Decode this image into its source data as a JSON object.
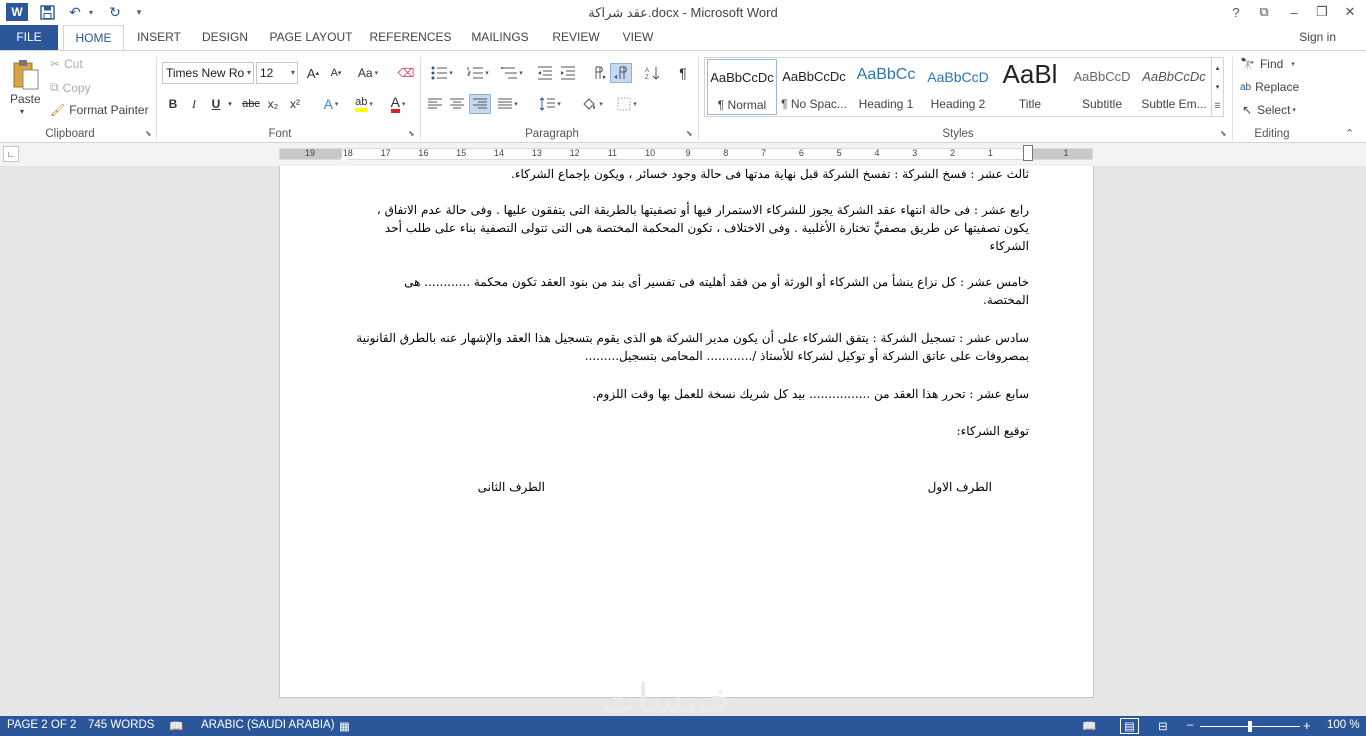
{
  "window": {
    "title": "عقد شراكة.docx - Microsoft Word",
    "help": "?",
    "ribbon_display": "⧉",
    "minimize": "–",
    "maximize": "❐",
    "close": "✕"
  },
  "quick_access": {
    "word_icon": "W",
    "save_icon": "💾",
    "undo_icon": "↶",
    "redo_icon": "↻",
    "customize_icon": "▾"
  },
  "tabs": [
    {
      "label": "FILE"
    },
    {
      "label": "HOME"
    },
    {
      "label": "INSERT"
    },
    {
      "label": "DESIGN"
    },
    {
      "label": "PAGE LAYOUT"
    },
    {
      "label": "REFERENCES"
    },
    {
      "label": "MAILINGS"
    },
    {
      "label": "REVIEW"
    },
    {
      "label": "VIEW"
    }
  ],
  "signin": "Sign in",
  "clipboard": {
    "paste": "Paste",
    "cut": "Cut",
    "copy": "Copy",
    "format_painter": "Format Painter",
    "label": "Clipboard"
  },
  "font": {
    "name": "Times New Ro",
    "size": "12",
    "label": "Font",
    "bold": "B",
    "italic": "I",
    "underline": "U",
    "strikethrough": "abc",
    "subscript": "x₂",
    "superscript": "x²",
    "grow": "A",
    "shrink": "A",
    "change_case": "Aa",
    "text_effects": "A",
    "highlight": "ab",
    "font_color": "A"
  },
  "paragraph": {
    "label": "Paragraph"
  },
  "styles": {
    "label": "Styles",
    "items": [
      {
        "sample": "AaBbCcDc",
        "name": "¶ Normal"
      },
      {
        "sample": "AaBbCcDc",
        "name": "¶ No Spac..."
      },
      {
        "sample": "AaBbCc",
        "name": "Heading 1"
      },
      {
        "sample": "AaBbCcD",
        "name": "Heading 2"
      },
      {
        "sample": "AaBl",
        "name": "Title"
      },
      {
        "sample": "AaBbCcD",
        "name": "Subtitle"
      },
      {
        "sample": "AaBbCcDc",
        "name": "Subtle Em..."
      }
    ]
  },
  "editing": {
    "find": "Find",
    "replace": "Replace",
    "select": "Select",
    "label": "Editing"
  },
  "ruler": {
    "numbers": [
      "19",
      "18",
      "17",
      "16",
      "15",
      "14",
      "13",
      "12",
      "11",
      "10",
      "9",
      "8",
      "7",
      "6",
      "5",
      "4",
      "3",
      "2",
      "1",
      "1"
    ]
  },
  "document": {
    "paragraphs": [
      "ثالث عشر : فسخ الشركة : تفسخ الشركة قبل نهاية مدتها فى حالة وجود خسائر ، ويكون بإجماع الشركاء.",
      "رابع عشر : فى حالة انتهاء عقد الشركة يجوز للشركاء الاستمرار فيها أو تصفيتها بالطريقة التى يتفقون عليها . وفى حالة عدم الاتفاق ، يكون تصفيتها عن طريق مصفيٍّ تختارة الأغلبية . وفى الاختلاف ، تكون المحكمة المختصة هى التى تتولى التصفية بناء على طلب أحد الشركاء",
      "خامس عشر : كل نزاع ينشأ من الشركاء أو الورثة أو من فقد أهليته فى تفسير أى بند من بنود العقد تكون محكمة ............ هى المختصة.",
      "سادس عشر : تسجيل الشركة : يتفق الشركاء على أن يكون مدير الشركة هو الذى يقوم بتسجيل هذا العقد والإشهار عنه بالطرق القانونية بمصروفات على عاتق الشركة أو توكيل لشركاء للأستاذ /............ المحامى بتسجيل.........",
      "سابع عشر : تحرر هذا العقد من ................ بيد كل شريك نسخة للعمل بها وقت اللزوم.",
      "توقيع الشركاء:"
    ],
    "party_first": "الطرف الاول",
    "party_second": "الطرف الثانى"
  },
  "status": {
    "page": "PAGE 2 OF 2",
    "words": "745 WORDS",
    "language": "ARABIC (SAUDI ARABIA)",
    "zoom": "100 %",
    "zoom_out": "–",
    "zoom_in": "+",
    "zoom_fraction": 0.5
  },
  "watermark": "خمسات",
  "colors": {
    "accent": "#2b579a"
  }
}
